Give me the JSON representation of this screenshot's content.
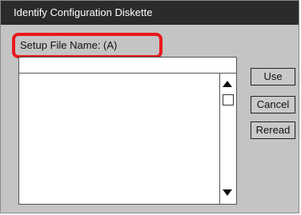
{
  "window": {
    "title": "Identify Configuration Diskette"
  },
  "setup_file": {
    "label": "Setup File Name: (A)"
  },
  "file_list": {
    "items": []
  },
  "buttons": {
    "use": "Use",
    "cancel": "Cancel",
    "reread": "Reread"
  },
  "icons": {
    "scroll_up": "arrow-up-icon",
    "scroll_down": "arrow-down-icon"
  },
  "colors": {
    "title_bar": "#2b2b2b",
    "dialog_bg": "#c4c4c4",
    "highlight": "#e8191c"
  }
}
